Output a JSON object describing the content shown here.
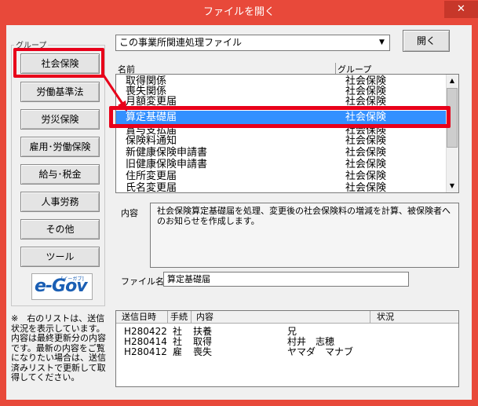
{
  "window": {
    "title": "ファイルを開く",
    "close_glyph": "✕"
  },
  "groups": {
    "label": "グループ",
    "buttons": [
      "社会保険",
      "労働基準法",
      "労災保険",
      "雇用･労働保険",
      "給与･税金",
      "人事労務",
      "その他",
      "ツール"
    ],
    "selected": "社会保険"
  },
  "logo": {
    "text": "e-Gov",
    "small": "[イーガブ]"
  },
  "notes": "※　右のリストは、送信状況を表示しています。\n内容は最終更新分の内容です。最新の内容をご覧になりたい場合は、送信済みリストで更新して取得してください。",
  "combo": {
    "value": "この事業所関連処理ファイル",
    "arrow_glyph": "▼"
  },
  "open_button": "開く",
  "file_list": {
    "col_name": "名前",
    "col_group": "グループ",
    "rows": [
      {
        "name": "取得関係",
        "group": "社会保険"
      },
      {
        "name": "喪失関係",
        "group": "社会保険"
      },
      {
        "name": "月額変更届",
        "group": "社会保険"
      },
      {
        "name": "算定基礎届",
        "group": "社会保険",
        "selected": true
      },
      {
        "name": "賞与支払届",
        "group": "社会保険"
      },
      {
        "name": "保険料通知",
        "group": "社会保険"
      },
      {
        "name": "新健康保険申請書",
        "group": "社会保険"
      },
      {
        "name": "旧健康保険申請書",
        "group": "社会保険"
      },
      {
        "name": "住所変更届",
        "group": "社会保険"
      },
      {
        "name": "氏名変更届",
        "group": "社会保険"
      }
    ]
  },
  "description": {
    "label": "内容",
    "text": "社会保険算定基礎届を処理、変更後の社会保険料の増減を計算、被保険者へのお知らせを作成します。"
  },
  "filename": {
    "label": "ファイル名",
    "value": "算定基礎届"
  },
  "history": {
    "headers": [
      "送信日時",
      "手続",
      "内容",
      "状況"
    ],
    "rows": [
      {
        "date": "H280422",
        "proc": "社",
        "kind": "扶養",
        "content": "兄"
      },
      {
        "date": "H280414",
        "proc": "社",
        "kind": "取得",
        "content": "村井　志穂"
      },
      {
        "date": "H280412",
        "proc": "雇",
        "kind": "喪失",
        "content": "ヤマダ　マナブ"
      }
    ]
  },
  "colors": {
    "frame": "#e8493a",
    "highlight": "#e8001a",
    "selection": "#3390ff"
  }
}
